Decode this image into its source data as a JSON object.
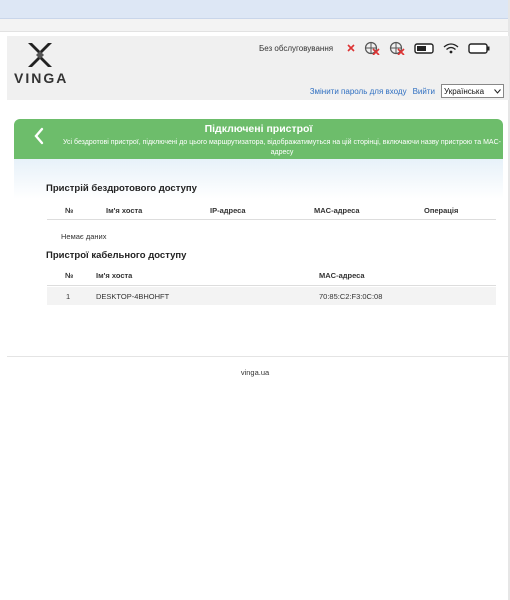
{
  "header": {
    "brand": "VINGA",
    "status_text": "Без обслуговування",
    "change_password_label": "Змінити пароль для входу",
    "logout_label": "Вийти",
    "language_selected": "Українська",
    "icons": [
      "close-icon",
      "no-internet-icon",
      "no-network-icon",
      "sim-icon",
      "wifi-icon",
      "battery-icon"
    ]
  },
  "banner": {
    "title": "Підключені пристрої",
    "description": "Усі бездротові пристрої, підключені до цього маршрутизатора, відображатимуться на цій сторінці, включаючи назву пристрою та MAC-адресу",
    "bg_color": "#6dbd6b"
  },
  "wireless": {
    "title": "Пристрій бездротового доступу",
    "columns": [
      "№",
      "Ім'я хоста",
      "IP-адреса",
      "MAC-адреса",
      "Операція"
    ],
    "empty_text": "Немає даних"
  },
  "wired": {
    "title": "Пристрої кабельного доступу",
    "columns": [
      "№",
      "Ім'я хоста",
      "MAC-адреса"
    ],
    "rows": [
      {
        "no": "1",
        "host": "DESKTOP-4BHOHFT",
        "mac": "70:85:C2:F3:0C:08"
      }
    ]
  },
  "footer": {
    "link": "vinga.ua"
  }
}
